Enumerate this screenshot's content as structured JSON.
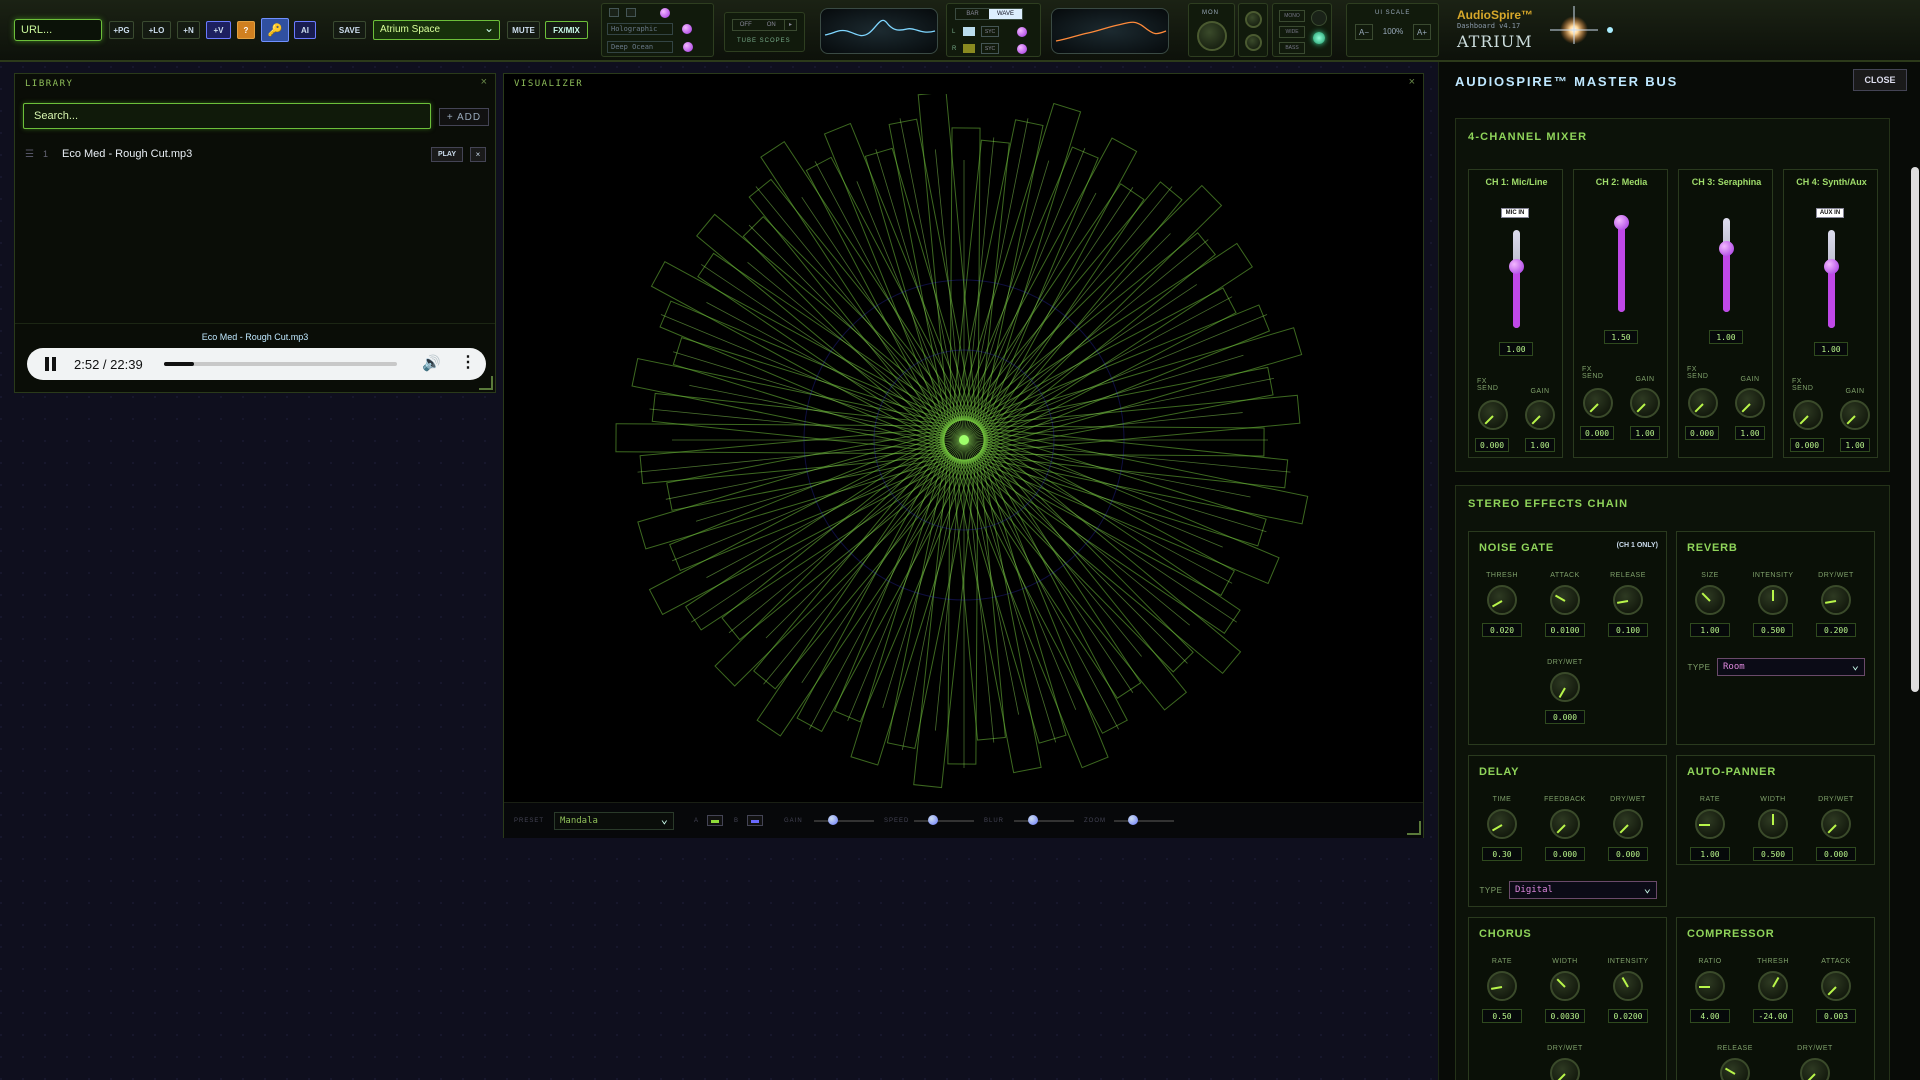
{
  "toolbar": {
    "url_placeholder": "URL...",
    "buttons": [
      "+PG",
      "+LO",
      "+N",
      "+V",
      "?",
      "AI",
      "SAVE",
      "MUTE",
      "FX/MIX"
    ],
    "preset": "Atrium Space",
    "theme_options": [
      "Holographic",
      "Deep Ocean"
    ],
    "tube_off": "OFF",
    "tube_on": "ON",
    "tube_label": "TUBE SCOPES",
    "bar_label": "BAR",
    "wave_label": "WAVE",
    "sync1": "SYC",
    "sync2": "SYC",
    "mon_label": "MON",
    "mode_labels": [
      "MONO",
      "WIDE",
      "BASS"
    ],
    "ui_scale_label": "UI SCALE",
    "scale_minus": "A−",
    "scale_value": "100%",
    "scale_plus": "A+",
    "brand_name": "AudioSpire™",
    "brand_sub": "Dashboard v4.17",
    "brand_logo": "ATRIUM"
  },
  "library": {
    "title": "LIBRARY",
    "close": "×",
    "search_placeholder": "Search...",
    "add_label": "+ ADD",
    "tracks": [
      {
        "index": "1",
        "name": "Eco Med - Rough Cut.mp3",
        "play": "PLAY",
        "remove": "×"
      }
    ],
    "now_playing": "Eco Med - Rough Cut.mp3",
    "time": "2:52 / 22:39",
    "progress": 0.127
  },
  "visualizer": {
    "title": "VISUALIZER",
    "close": "×",
    "preset_label": "PRESET",
    "preset_value": "Mandala",
    "color_a_label": "A",
    "color_b_label": "B",
    "sliders": [
      {
        "label": "GAIN",
        "value": 0.5
      },
      {
        "label": "SPEED",
        "value": 0.5
      },
      {
        "label": "BLUR",
        "value": 0.5
      },
      {
        "label": "ZOOM",
        "value": 0.5
      }
    ]
  },
  "master": {
    "title": "AUDIOSPIRE™ MASTER BUS",
    "close": "CLOSE",
    "mixer_title": "4-CHANNEL MIXER",
    "channels": [
      {
        "name": "CH 1: Mic/Line",
        "badge": "MIC IN",
        "fader": "1.00",
        "fx_send_label": "FX SEND",
        "gain_label": "GAIN",
        "fx_send": "0.000",
        "gain": "1.00"
      },
      {
        "name": "CH 2: Media",
        "badge": "",
        "fader": "1.50",
        "fx_send_label": "FX SEND",
        "gain_label": "GAIN",
        "fx_send": "0.000",
        "gain": "1.00"
      },
      {
        "name": "CH 3: Seraphina",
        "badge": "",
        "fader": "1.00",
        "fx_send_label": "FX SEND",
        "gain_label": "GAIN",
        "fx_send": "0.000",
        "gain": "1.00"
      },
      {
        "name": "CH 4: Synth/Aux",
        "badge": "AUX IN",
        "fader": "1.00",
        "fx_send_label": "FX SEND",
        "gain_label": "GAIN",
        "fx_send": "0.000",
        "gain": "1.00"
      }
    ],
    "fx_title": "STEREO EFFECTS CHAIN",
    "noise_gate": {
      "title": "NOISE GATE",
      "note": "(CH 1 ONLY)",
      "labels": [
        "THRESH",
        "ATTACK",
        "RELEASE",
        "DRY/WET"
      ],
      "values": [
        "0.020",
        "0.0100",
        "0.100",
        "0.000"
      ]
    },
    "reverb": {
      "title": "REVERB",
      "labels": [
        "SIZE",
        "INTENSITY",
        "DRY/WET"
      ],
      "values": [
        "1.00",
        "0.500",
        "0.200"
      ],
      "type_label": "TYPE",
      "type": "Room"
    },
    "delay": {
      "title": "DELAY",
      "labels": [
        "TIME",
        "FEEDBACK",
        "DRY/WET"
      ],
      "values": [
        "0.30",
        "0.000",
        "0.000"
      ],
      "type_label": "TYPE",
      "type": "Digital"
    },
    "autopanner": {
      "title": "AUTO-PANNER",
      "labels": [
        "RATE",
        "WIDTH",
        "DRY/WET"
      ],
      "values": [
        "1.00",
        "0.500",
        "0.000"
      ]
    },
    "chorus": {
      "title": "CHORUS",
      "labels": [
        "RATE",
        "WIDTH",
        "INTENSITY",
        "DRY/WET"
      ],
      "values": [
        "0.50",
        "0.0030",
        "0.0200"
      ]
    },
    "compressor": {
      "title": "COMPRESSOR",
      "labels": [
        "RATIO",
        "THRESH",
        "ATTACK",
        "RELEASE",
        "DRY/WET"
      ],
      "values": [
        "4.00",
        "-24.00",
        "0.003"
      ]
    }
  }
}
